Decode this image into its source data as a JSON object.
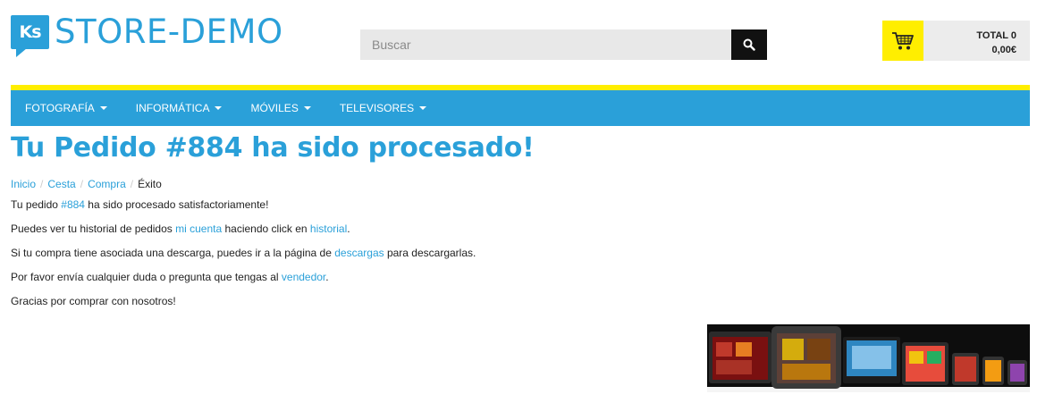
{
  "logo": {
    "badge": "Ks",
    "text": "STORE-DEMO"
  },
  "search": {
    "placeholder": "Buscar",
    "icon": "search-icon"
  },
  "cart": {
    "total_label": "TOTAL 0",
    "amount": "0,00€",
    "icon": "shopping-cart-icon"
  },
  "colors": {
    "brand_blue": "#2aa0d9",
    "accent_yellow": "#ffee00"
  },
  "nav": {
    "items": [
      {
        "label": "FOTOGRAFÍA"
      },
      {
        "label": "INFORMÁTICA"
      },
      {
        "label": "MÓVILES"
      },
      {
        "label": "TELEVISORES"
      }
    ]
  },
  "page": {
    "title": "Tu Pedido #884 ha sido procesado!",
    "breadcrumb": [
      "Inicio",
      "Cesta",
      "Compra",
      "Éxito"
    ],
    "p1": {
      "before": "Tu pedido ",
      "link": "#884",
      "after": " ha sido procesado satisfactoriamente!"
    },
    "p2": {
      "before": "Puedes ver tu historial de pedidos ",
      "link1": "mi cuenta",
      "middle": " haciendo click en ",
      "link2": "historial",
      "after": "."
    },
    "p3": {
      "before": "Si tu compra tiene asociada una descarga, puedes ir a la página de ",
      "link": "descargas",
      "after": " para descargarlas."
    },
    "p4": {
      "before": "Por favor envía cualquier duda o pregunta que tengas al ",
      "link": "vendedor",
      "after": "."
    },
    "p5": "Gracias por comprar con nosotros!"
  }
}
